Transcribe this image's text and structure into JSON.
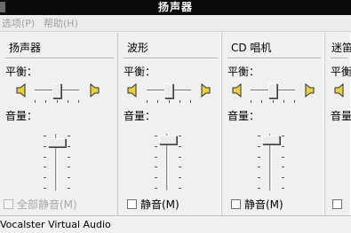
{
  "window": {
    "title": "扬声器"
  },
  "menu": {
    "options": "选项(P)",
    "help": "帮助(H)"
  },
  "labels": {
    "balance": "平衡：",
    "volume": "音量："
  },
  "columns": [
    {
      "title": "扬声器",
      "balance": 0.5,
      "volume": 0.85,
      "mute_label": "全部静音(M)",
      "mute_enabled": false,
      "muted": false
    },
    {
      "title": "波形",
      "balance": 0.5,
      "volume": 0.9,
      "mute_label": "静音(M)",
      "mute_enabled": true,
      "muted": false
    },
    {
      "title": "CD 唱机",
      "balance": 0.5,
      "volume": 0.9,
      "mute_label": "静音(M)",
      "mute_enabled": true,
      "muted": false
    },
    {
      "title": "迷笛",
      "balance": 0.5,
      "volume": 0.9,
      "mute_label": "",
      "mute_enabled": true,
      "muted": false
    }
  ],
  "status": {
    "text": "Vocalster Virtual Audio"
  },
  "colors": {
    "titlebar": "#0a0a0a",
    "window_bg": "#f0f0f0",
    "disabled_text": "#a0a0a0"
  }
}
